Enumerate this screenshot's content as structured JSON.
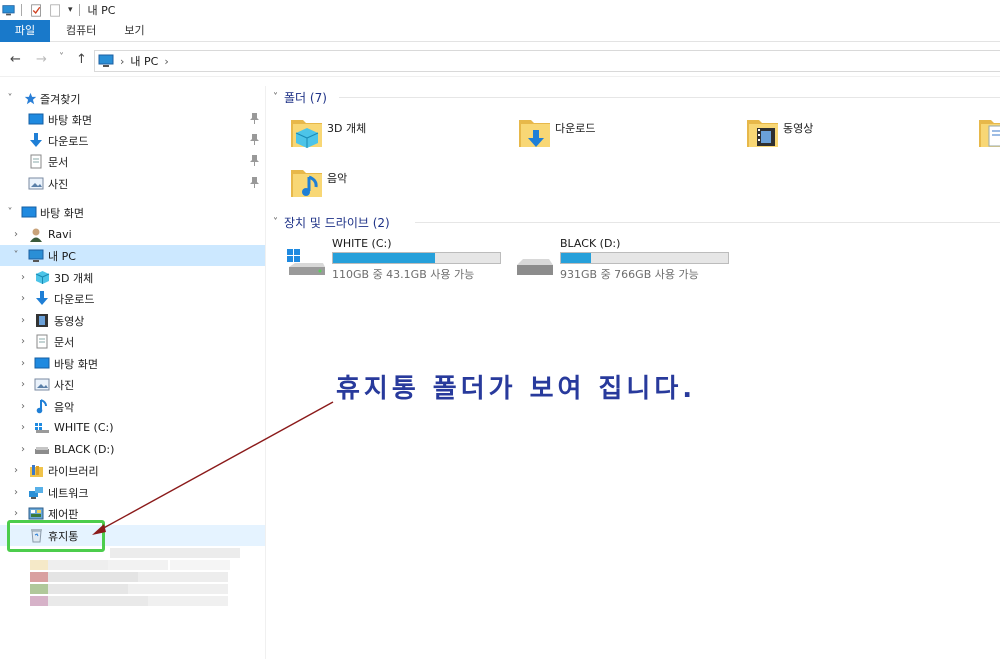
{
  "window": {
    "title": "내 PC"
  },
  "ribbon": {
    "tabs": [
      "파일",
      "컴퓨터",
      "보기"
    ]
  },
  "address": {
    "location": "내 PC"
  },
  "nav": {
    "back": "←",
    "forward": "→",
    "recent": "˅",
    "up": "↑"
  },
  "sidebar": {
    "items": [
      {
        "label": "즐겨찾기",
        "icon": "star-icon",
        "expanded": true
      },
      {
        "label": "바탕 화면",
        "icon": "desktop-icon",
        "pinned": true
      },
      {
        "label": "다운로드",
        "icon": "download-arrow-icon",
        "pinned": true
      },
      {
        "label": "문서",
        "icon": "document-icon",
        "pinned": true
      },
      {
        "label": "사진",
        "icon": "picture-icon",
        "pinned": true
      },
      {
        "label": "바탕 화면",
        "icon": "desktop-icon",
        "expanded": true
      },
      {
        "label": "Ravi",
        "icon": "user-icon"
      },
      {
        "label": "내 PC",
        "icon": "computer-icon",
        "expanded": true,
        "selected": true
      },
      {
        "label": "3D 개체",
        "icon": "3d-cube-icon"
      },
      {
        "label": "다운로드",
        "icon": "download-arrow-icon"
      },
      {
        "label": "동영상",
        "icon": "film-icon"
      },
      {
        "label": "문서",
        "icon": "document-icon"
      },
      {
        "label": "바탕 화면",
        "icon": "desktop-icon"
      },
      {
        "label": "사진",
        "icon": "picture-icon"
      },
      {
        "label": "음악",
        "icon": "music-note-icon"
      },
      {
        "label": "WHITE (C:)",
        "icon": "windows-drive-icon"
      },
      {
        "label": "BLACK (D:)",
        "icon": "drive-icon"
      },
      {
        "label": "라이브러리",
        "icon": "library-icon"
      },
      {
        "label": "네트워크",
        "icon": "network-icon"
      },
      {
        "label": "제어판",
        "icon": "control-panel-icon"
      },
      {
        "label": "휴지통",
        "icon": "recycle-bin-icon"
      }
    ]
  },
  "content": {
    "folders_header": "폴더 (7)",
    "folders": [
      {
        "label": "3D 개체",
        "icon": "3d-folder-icon"
      },
      {
        "label": "다운로드",
        "icon": "download-folder-icon"
      },
      {
        "label": "동영상",
        "icon": "video-folder-icon"
      },
      {
        "label": "음악",
        "icon": "music-folder-icon"
      }
    ],
    "drives_header": "장치 및 드라이브 (2)",
    "drives": [
      {
        "name": "WHITE (C:)",
        "info": "110GB 중 43.1GB 사용 가능",
        "used_fraction": 0.61
      },
      {
        "name": "BLACK (D:)",
        "info": "931GB 중 766GB 사용 가능",
        "used_fraction": 0.18
      }
    ]
  },
  "annotation": {
    "text": "휴지통 폴더가 보여 집니다."
  },
  "colors": {
    "accent": "#1979ca",
    "selected": "#cce8ff",
    "drive_fill": "#26a0da",
    "annotation": "#283a9c",
    "highlight": "#4ccd4c",
    "arrow": "#8b1a1a"
  }
}
